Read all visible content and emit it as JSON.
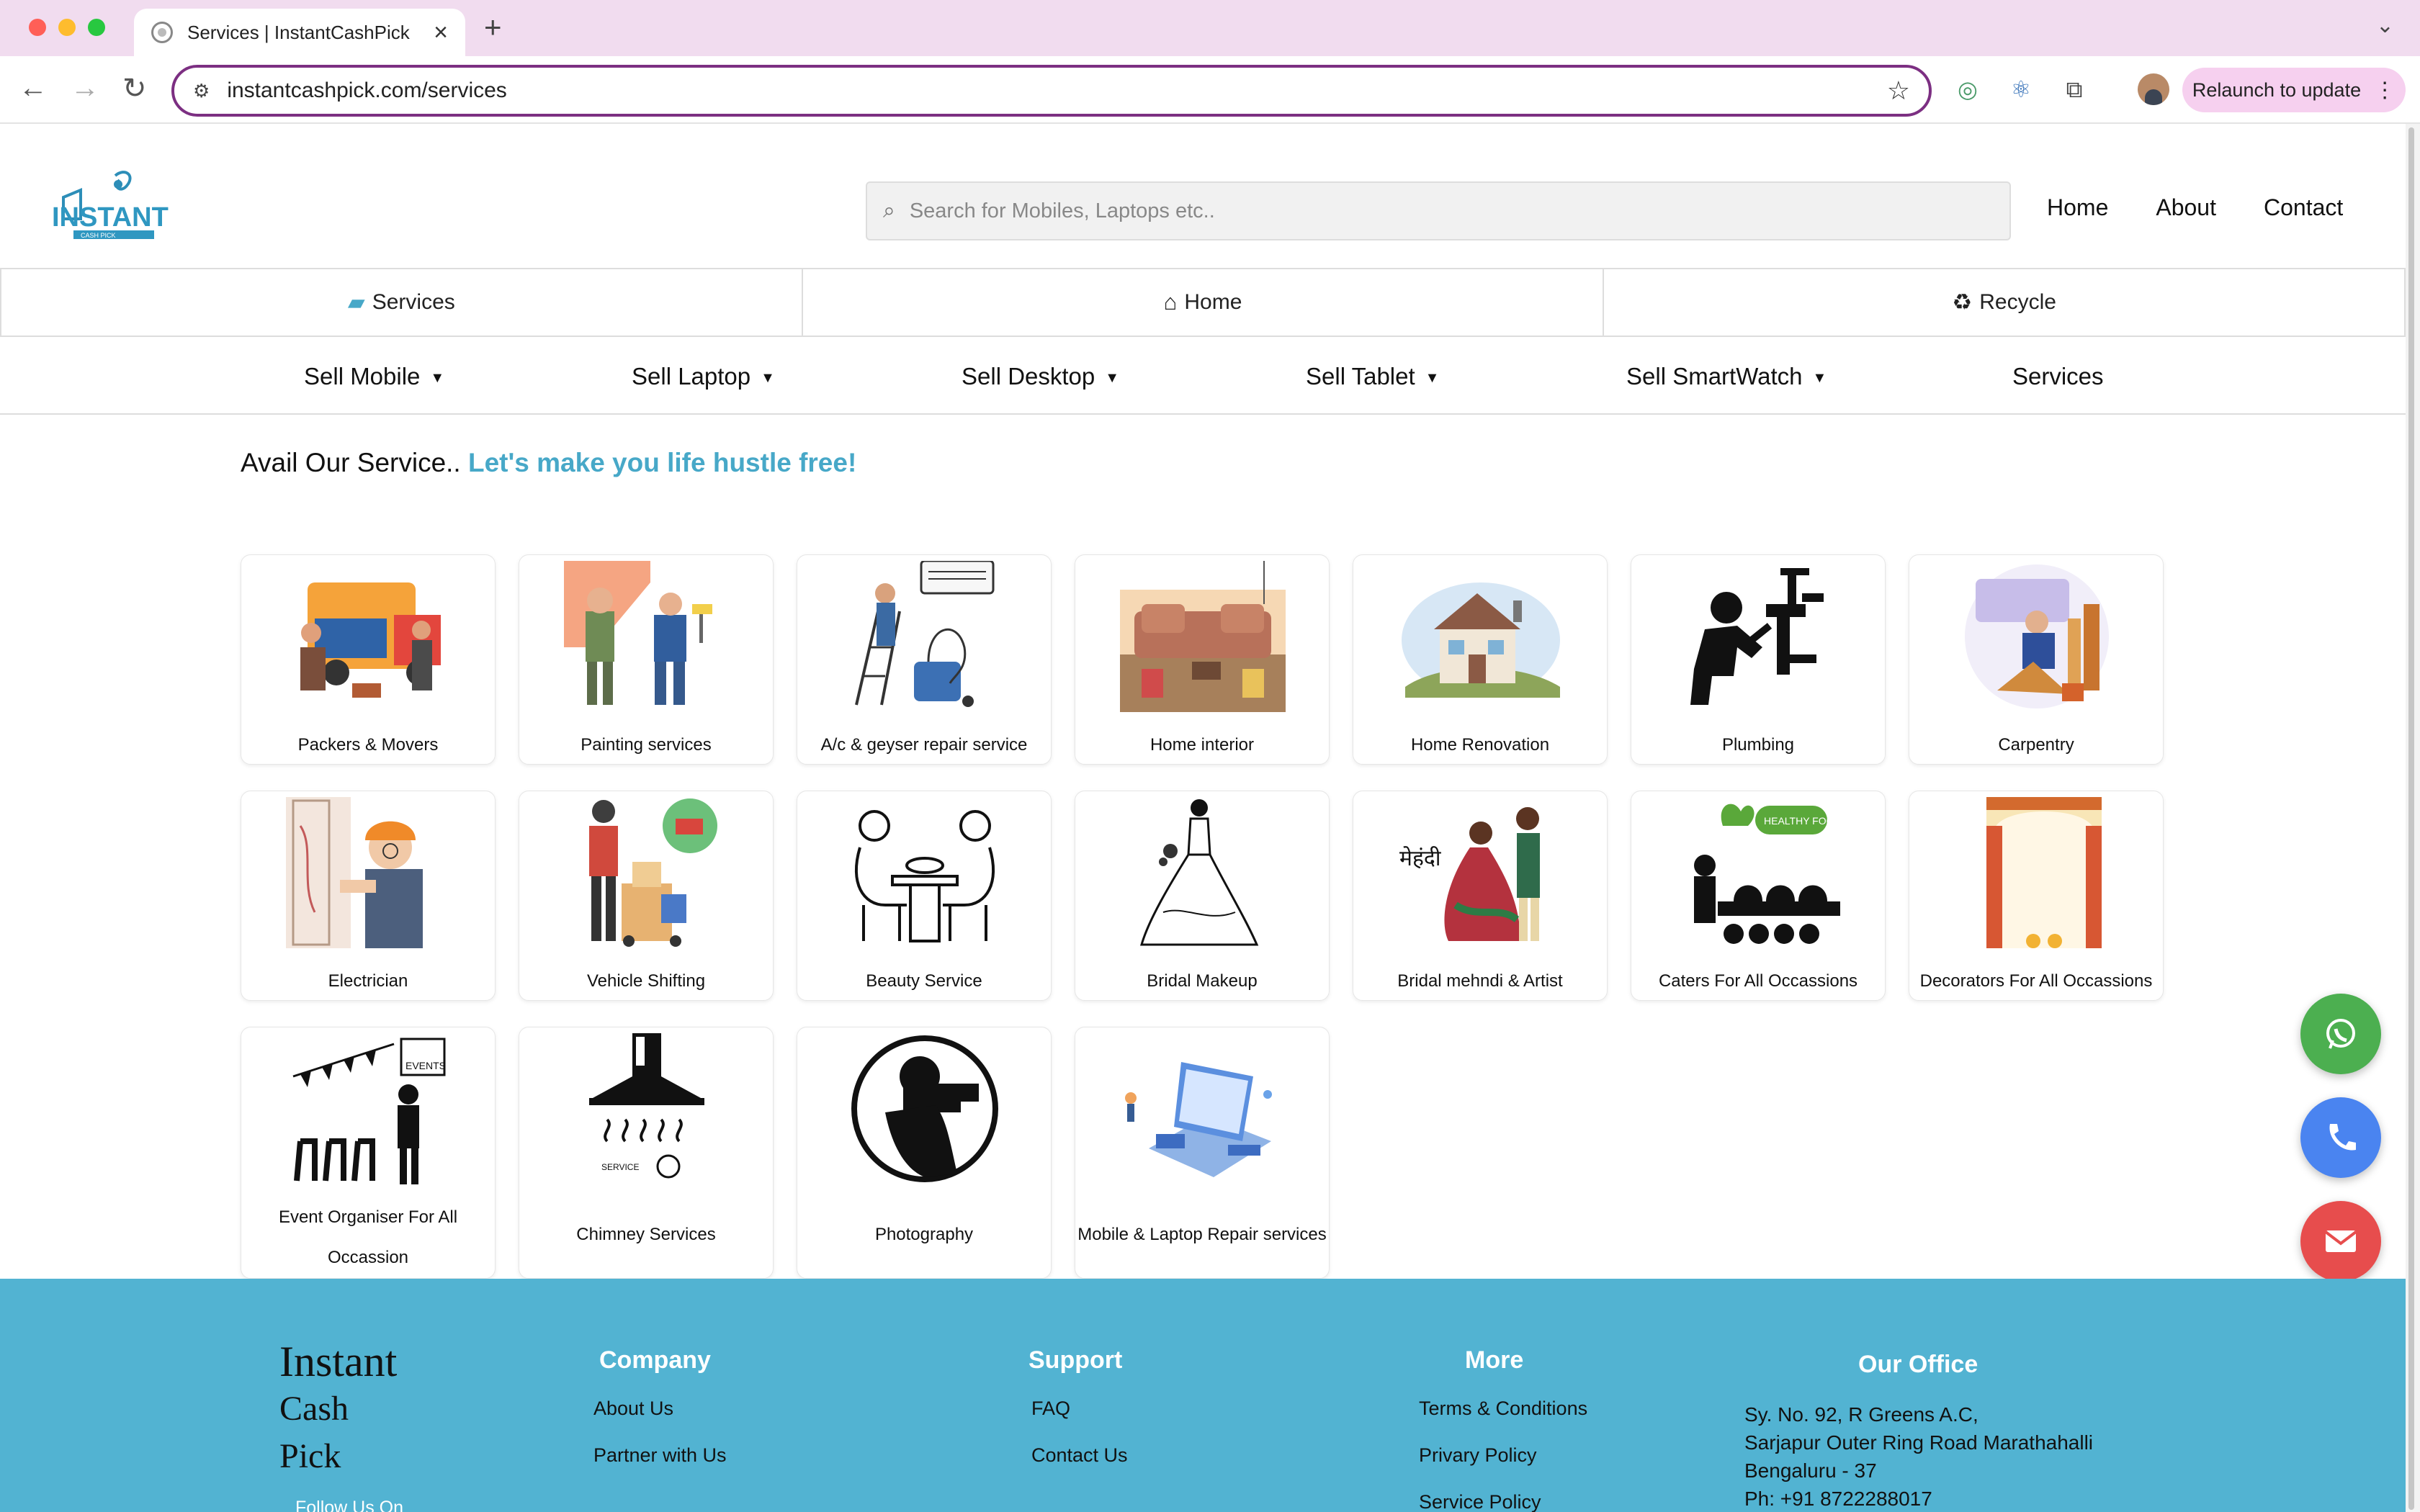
{
  "browser": {
    "tab_title": "Services | InstantCashPick",
    "url": "instantcashpick.com/services",
    "relaunch_label": "Relaunch to update"
  },
  "header": {
    "logo_text": "INSTANT",
    "logo_subtext": "CASH PICK",
    "search_placeholder": "Search for Mobiles, Laptops etc..",
    "nav": [
      "Home",
      "About",
      "Contact"
    ]
  },
  "quick_tabs": [
    "Services",
    "Home",
    "Recycle"
  ],
  "menu": [
    "Sell Mobile",
    "Sell Laptop",
    "Sell Desktop",
    "Sell Tablet",
    "Sell SmartWatch",
    "Services"
  ],
  "intro": {
    "plain": "Avail Our Service.. ",
    "highlight": "Let's make you life hustle free!"
  },
  "services": [
    {
      "title": "Packers & Movers",
      "icon": "moving-truck-icon"
    },
    {
      "title": "Painting services",
      "icon": "painter-icon"
    },
    {
      "title": "A/c & geyser repair service",
      "icon": "ac-repair-icon"
    },
    {
      "title": "Home interior",
      "icon": "home-interior-icon"
    },
    {
      "title": "Home Renovation",
      "icon": "house-renovation-icon"
    },
    {
      "title": "Plumbing",
      "icon": "plumber-icon"
    },
    {
      "title": "Carpentry",
      "icon": "carpenter-icon"
    },
    {
      "title": "Electrician",
      "icon": "electrician-icon"
    },
    {
      "title": "Vehicle Shifting",
      "icon": "vehicle-shifting-icon"
    },
    {
      "title": "Beauty Service",
      "icon": "beauty-service-icon"
    },
    {
      "title": "Bridal Makeup",
      "icon": "bridal-gown-icon"
    },
    {
      "title": "Bridal mehndi & Artist",
      "icon": "mehndi-couple-icon"
    },
    {
      "title": "Caters For All Occassions",
      "icon": "catering-icon"
    },
    {
      "title": "Decorators For All Occassions",
      "icon": "decorations-icon"
    },
    {
      "title": "Event Organiser For All Occassion",
      "icon": "event-organiser-icon"
    },
    {
      "title": "Chimney Services",
      "icon": "chimney-icon"
    },
    {
      "title": "Photography",
      "icon": "camera-man-icon"
    },
    {
      "title": "Mobile & Laptop Repair services",
      "icon": "device-repair-icon"
    }
  ],
  "icon_text": {
    "healthy_food": "HEALTHY FOOD",
    "mehndi": "मेहंदी",
    "events": "EVENTS",
    "service": "SERVICE"
  },
  "floating_buttons": [
    {
      "name": "whatsapp",
      "color": "#4caf50"
    },
    {
      "name": "phone",
      "color": "#4a84f0"
    },
    {
      "name": "email",
      "color": "#e74d4d"
    }
  ],
  "footer": {
    "brand_lines": [
      "Instant",
      "Cash",
      "Pick"
    ],
    "follow": "Follow Us On",
    "company": {
      "heading": "Company",
      "links": [
        "About Us",
        "Partner with Us"
      ]
    },
    "support": {
      "heading": "Support",
      "links": [
        "FAQ",
        "Contact Us"
      ]
    },
    "more": {
      "heading": "More",
      "links": [
        "Terms & Conditions",
        "Privary Policy",
        "Service Policy"
      ]
    },
    "office": {
      "heading": "Our Office",
      "lines": [
        "Sy. No. 92, R Greens A.C,",
        "Sarjapur Outer Ring Road Marathahalli",
        "Bengaluru - 37",
        "Ph: +91 8722288017"
      ]
    }
  },
  "colors": {
    "accent": "#47a8c8",
    "footer": "#52b3d2",
    "browser_accent": "#7c2f82"
  }
}
